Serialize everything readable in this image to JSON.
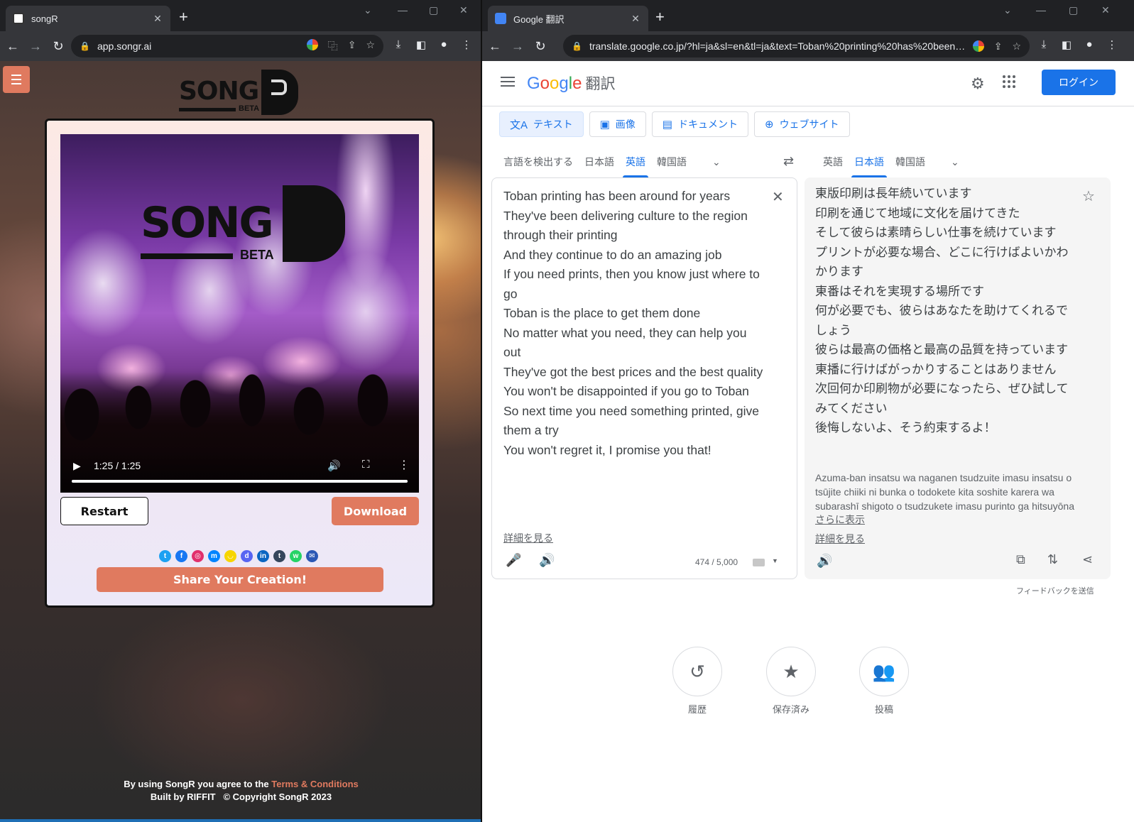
{
  "left": {
    "tab_title": "songR",
    "url": "app.songr.ai",
    "logo_text": "SONG",
    "logo_badge": "BETA",
    "video": {
      "time": "1:25 / 1:25",
      "progress": 1.0
    },
    "buttons": {
      "restart": "Restart",
      "download": "Download",
      "share": "Share Your Creation!"
    },
    "social": [
      {
        "name": "twitter-icon",
        "glyph": "t",
        "color": "#1da1f2"
      },
      {
        "name": "facebook-icon",
        "glyph": "f",
        "color": "#1877f2"
      },
      {
        "name": "instagram-icon",
        "glyph": "◎",
        "color": "#e1306c"
      },
      {
        "name": "messenger-icon",
        "glyph": "m",
        "color": "#0084ff"
      },
      {
        "name": "snapchat-icon",
        "glyph": "◡",
        "color": "#f7d500"
      },
      {
        "name": "discord-icon",
        "glyph": "d",
        "color": "#5865f2"
      },
      {
        "name": "linkedin-icon",
        "glyph": "in",
        "color": "#0a66c2"
      },
      {
        "name": "tumblr-icon",
        "glyph": "t",
        "color": "#35465c"
      },
      {
        "name": "whatsapp-icon",
        "glyph": "w",
        "color": "#25d366"
      },
      {
        "name": "email-icon",
        "glyph": "✉",
        "color": "#2b58b5"
      }
    ],
    "footer": {
      "agree": "By using SongR you agree to the ",
      "terms": "Terms & Conditions",
      "built": "Built by RIFFIT",
      "copyright": "© Copyright SongR 2023"
    },
    "accent": "#e07a5f"
  },
  "right": {
    "tab_title": "Google 翻訳",
    "url": "translate.google.co.jp/?hl=ja&sl=en&tl=ja&text=Toban%20printing%20has%20been%...",
    "brand_product": "翻訳",
    "login": "ログイン",
    "modes": [
      {
        "label": "テキスト",
        "icon": "文A",
        "active": true
      },
      {
        "label": "画像",
        "icon": "▣",
        "active": false
      },
      {
        "label": "ドキュメント",
        "icon": "▤",
        "active": false
      },
      {
        "label": "ウェブサイト",
        "icon": "⊕",
        "active": false
      }
    ],
    "source_langs": [
      "言語を検出する",
      "日本語",
      "英語",
      "韓国語"
    ],
    "source_selected": "英語",
    "target_langs": [
      "英語",
      "日本語",
      "韓国語"
    ],
    "target_selected": "日本語",
    "source_text": "Toban printing has been around for years\nThey've been delivering culture to the region through their printing\nAnd they continue to do an amazing job\nIf you need prints, then you know just where to go\nToban is the place to get them done\nNo matter what you need, they can help you out\nThey've got the best prices and the best quality\nYou won't be disappointed if you go to Toban\nSo next time you need something printed, give them a try\nYou won't regret it, I promise you that!",
    "target_text": "東版印刷は長年続いています\n印刷を通じて地域に文化を届けてきた\nそして彼らは素晴らしい仕事を続けています\nプリントが必要な場合、どこに行けばよいかわかります\n東番はそれを実現する場所です\n何が必要でも、彼らはあなたを助けてくれるでしょう\n彼らは最高の価格と最高の品質を持っています\n東播に行けばがっかりすることはありません\n次回何か印刷物が必要になったら、ぜひ試してみてください\n後悔しないよ、そう約束するよ！",
    "transliteration": "Azuma-ban insatsu wa naganen tsudzuite imasu insatsu o tsūjite chiiki ni bunka o todokete kita soshite karera wa subarashī shigoto o tsudzukete imasu purinto ga hitsuyōna",
    "show_more": "さらに表示",
    "details": "詳細を見る",
    "char_count": "474 / 5,000",
    "feedback": "フィードバックを送信",
    "bottom": [
      {
        "label": "履歴",
        "icon": "history-icon",
        "glyph": "↺"
      },
      {
        "label": "保存済み",
        "icon": "star-icon",
        "glyph": "★"
      },
      {
        "label": "投稿",
        "icon": "people-icon",
        "glyph": "👥"
      }
    ],
    "accent": "#1a73e8"
  }
}
